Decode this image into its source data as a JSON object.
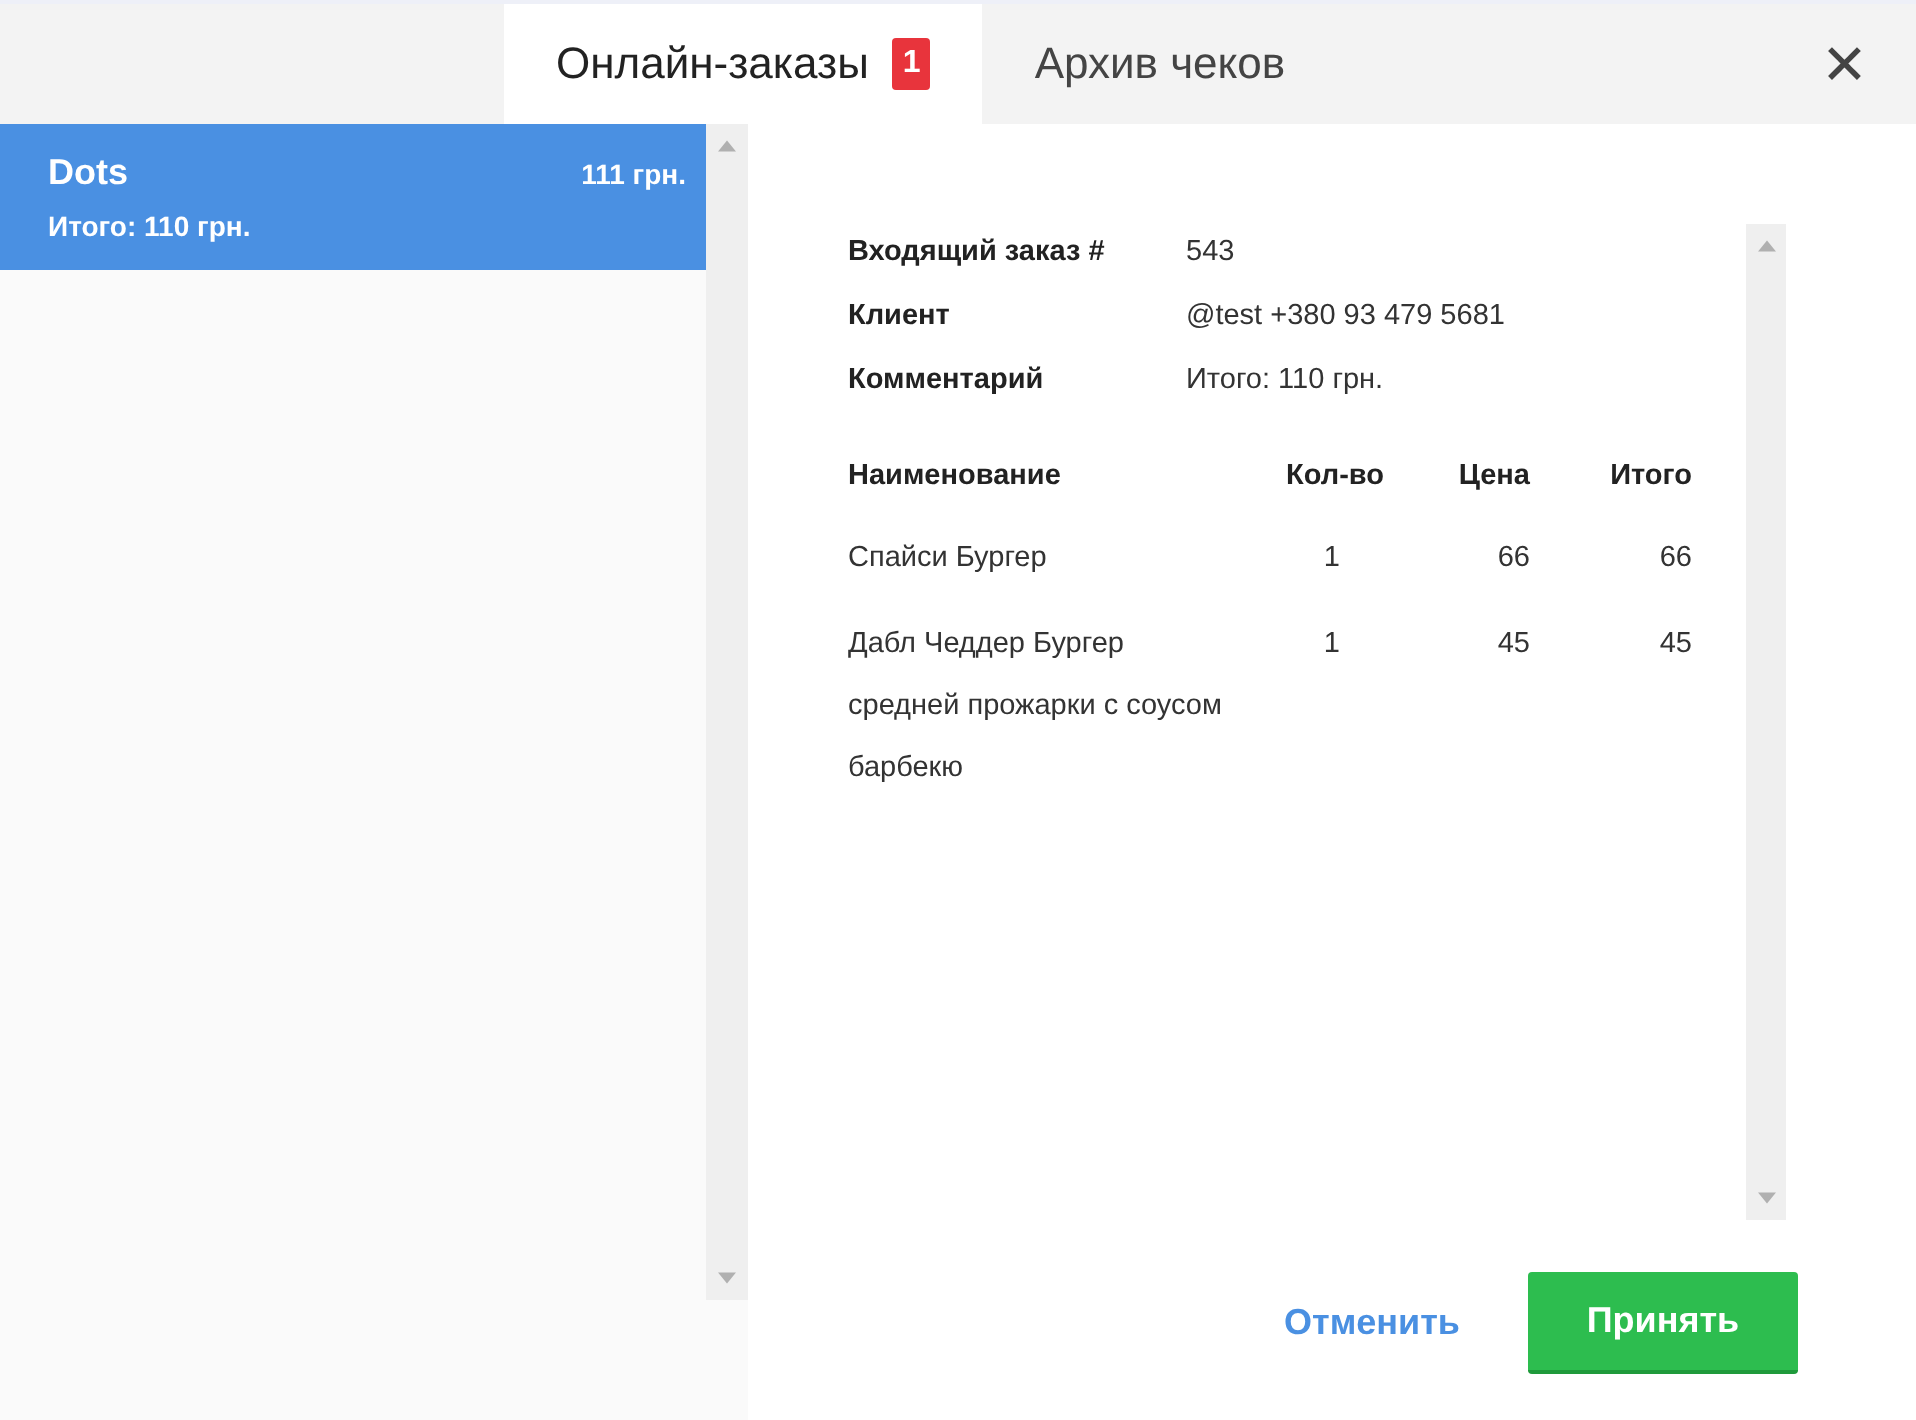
{
  "tabs": [
    {
      "label": "Онлайн-заказы",
      "badge": "1",
      "selected": true
    },
    {
      "label": "Архив чеков",
      "selected": false
    }
  ],
  "close": "✕",
  "orders": [
    {
      "name": "Dots",
      "amount": "111 грн.",
      "summary": "Итого: 110 грн.",
      "selected": true
    }
  ],
  "details": [
    {
      "label": "Входящий заказ #",
      "value": "543"
    },
    {
      "label": "Клиент",
      "value": "@test +380 93 479 5681"
    },
    {
      "label": "Комментарий",
      "value": "Итого: 110 грн."
    }
  ],
  "table": {
    "columns": [
      "Наименование",
      "Кол-во",
      "Цена",
      "Итого"
    ],
    "rows": [
      [
        "Спайси Бургер",
        "1",
        "66",
        "66"
      ],
      [
        "Дабл Чеддер Бургер средней прожарки с соусом барбекю",
        "1",
        "45",
        "45"
      ]
    ]
  },
  "buttons": {
    "cancel": "Отменить",
    "accept": "Принять"
  }
}
